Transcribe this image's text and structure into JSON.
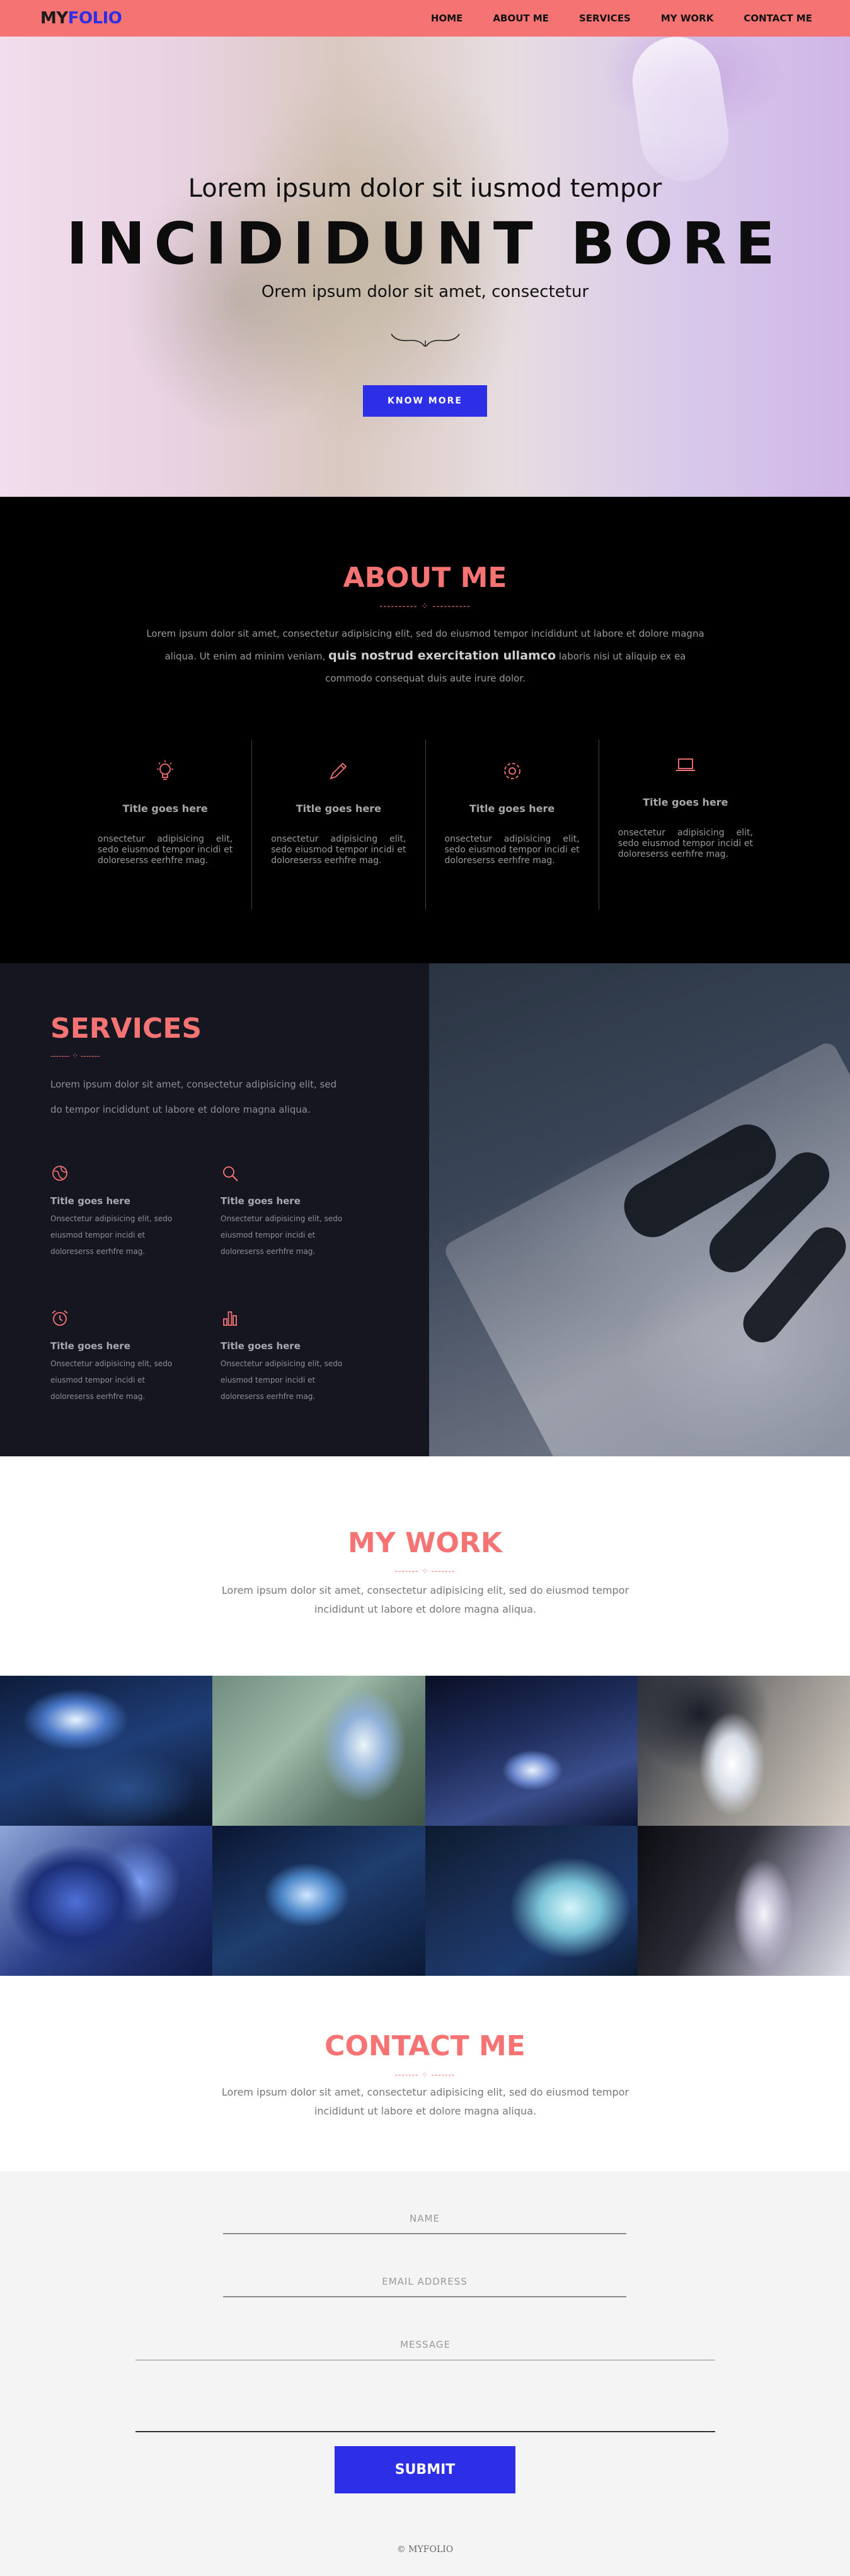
{
  "navbar": {
    "logo_my": "MY",
    "logo_folio": "FOLIO",
    "items": [
      "HOME",
      "ABOUT ME",
      "SERVICES",
      "MY WORK",
      "CONTACT ME"
    ]
  },
  "hero": {
    "subtitle": "Lorem ipsum dolor sit iusmod tempor",
    "title": "INCIDIDUNT BORE",
    "tagline": "Orem ipsum dolor sit amet, consectetur",
    "button_label": "KNOW MORE"
  },
  "about": {
    "title": "ABOUT ME",
    "ornament": "---------- ⁘ ----------",
    "text_part1": "Lorem ipsum dolor sit amet, consectetur adipisicing elit, sed do eiusmod tempor incididunt ut labore et dolore magna aliqua. Ut enim ad minim veniam, ",
    "text_bold": "quis nostrud exercitation ullamco",
    "text_part2": " laboris nisi ut aliquip ex ea commodo consequat duis aute irure dolor.",
    "features": [
      {
        "icon": "lightbulb-icon",
        "title": "Title goes here",
        "text": "onsectetur adipisicing elit, sedo eiusmod tempor incidi et doloreserss eerhfre mag."
      },
      {
        "icon": "pencil-icon",
        "title": "Title goes here",
        "text": "onsectetur adipisicing elit, sedo eiusmod tempor incidi et doloreserss eerhfre mag."
      },
      {
        "icon": "gear-icon",
        "title": "Title goes here",
        "text": "onsectetur adipisicing elit, sedo eiusmod tempor incidi et doloreserss eerhfre mag."
      },
      {
        "icon": "laptop-icon",
        "title": "Title goes here",
        "text": "onsectetur adipisicing elit, sedo eiusmod tempor incidi et doloreserss eerhfre mag."
      }
    ]
  },
  "services": {
    "title": "SERVICES",
    "ornament": "------- ⁘ -------",
    "text": "Lorem ipsum dolor sit amet, consectetur adipisicing elit, sed do tempor incididunt ut labore et dolore magna aliqua.",
    "items": [
      {
        "icon": "globe-icon",
        "title": "Title goes here",
        "text": "Onsectetur adipisicing elit, sedo eiusmod tempor incidi et doloreserss eerhfre mag."
      },
      {
        "icon": "search-icon",
        "title": "Title goes here",
        "text": "Onsectetur adipisicing elit, sedo eiusmod tempor incidi et doloreserss eerhfre mag."
      },
      {
        "icon": "alarm-clock-icon",
        "title": "Title goes here",
        "text": "Onsectetur adipisicing elit, sedo eiusmod tempor incidi et doloreserss eerhfre mag."
      },
      {
        "icon": "bar-chart-icon",
        "title": "Title goes here",
        "text": "Onsectetur adipisicing elit, sedo eiusmod tempor incidi et doloreserss eerhfre mag."
      }
    ]
  },
  "work": {
    "title": "MY WORK",
    "ornament": "------- ⁘ -------",
    "text": "Lorem ipsum dolor sit amet, consectetur adipisicing elit, sed do eiusmod tempor incididunt ut labore et dolore magna aliqua."
  },
  "contact": {
    "title": "CONTACT ME",
    "ornament": "------- ⁘ -------",
    "text": "Lorem ipsum dolor sit amet, consectetur adipisicing elit, sed do eiusmod tempor incididunt ut labore et dolore magna aliqua.",
    "name_label": "NAME",
    "email_label": "EMAIL ADDRESS",
    "message_label": "MESSAGE",
    "submit_label": "SUBMIT"
  },
  "footer": {
    "text": "© MYFOLIO"
  },
  "colors": {
    "accent": "#f57373",
    "brand_blue": "#2c2fe6",
    "about_bg": "#000000",
    "services_bg": "#161621",
    "form_bg": "#f4f4f4"
  }
}
